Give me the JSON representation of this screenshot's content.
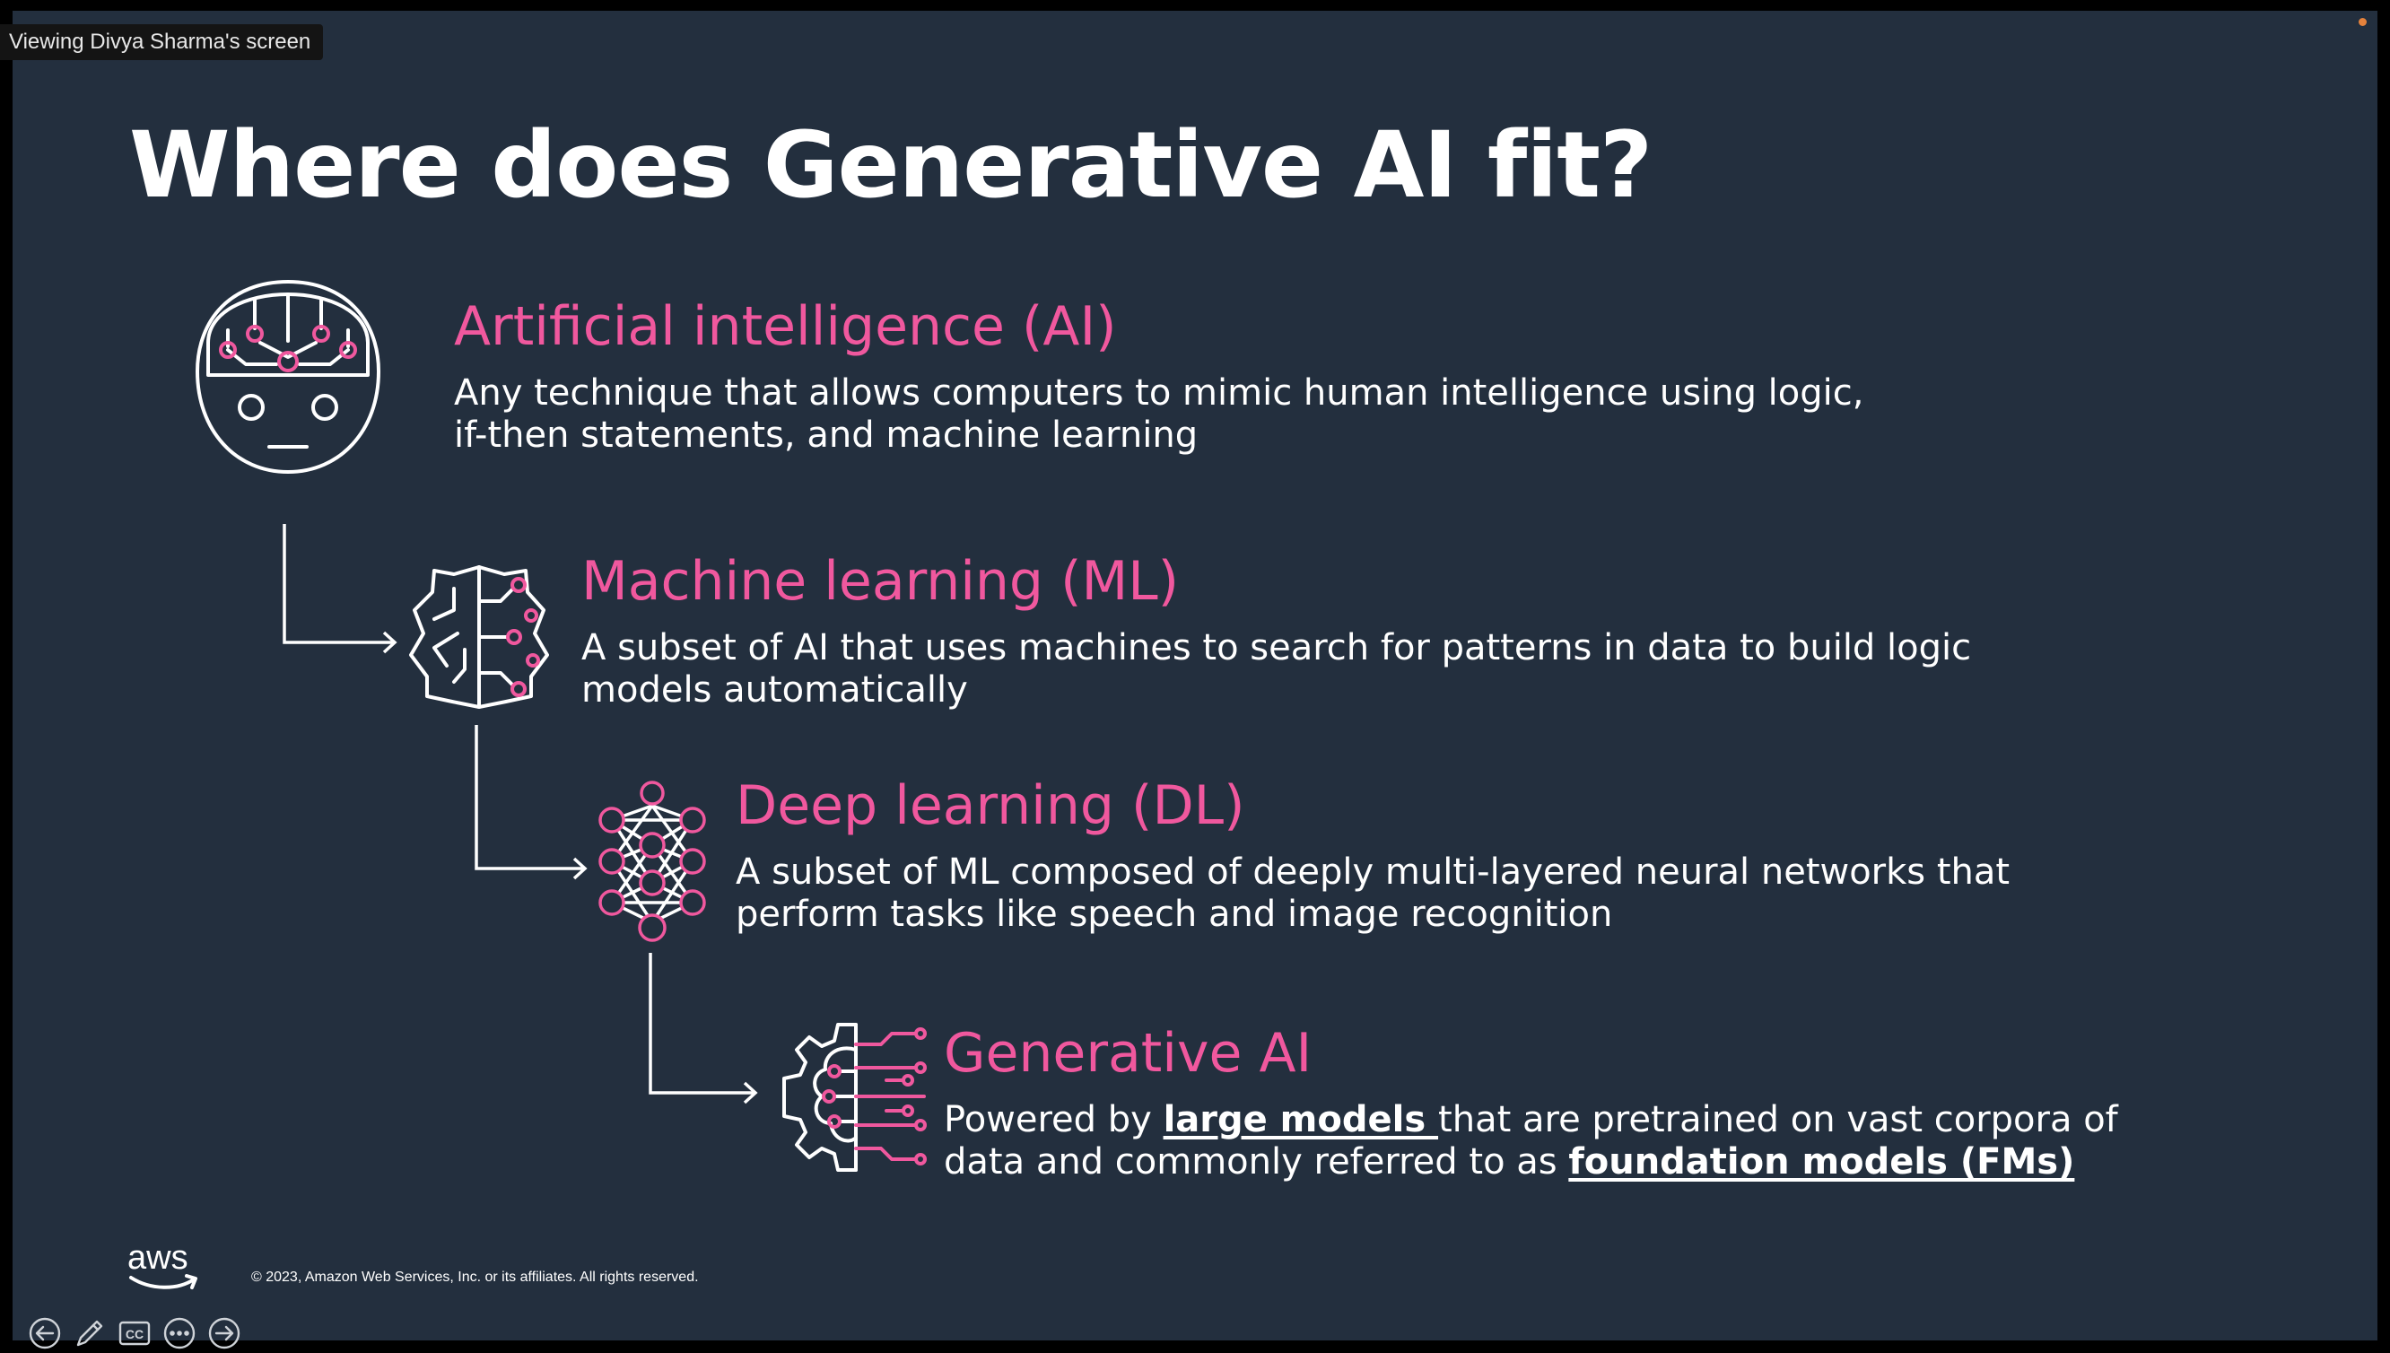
{
  "screen_share": {
    "viewing_label": "Viewing Divya Sharma's screen"
  },
  "slide": {
    "title": "Where does Generative AI fit?",
    "levels": [
      {
        "heading": "Artificial intelligence (AI)",
        "desc_line1": "Any technique that allows computers to mimic human intelligence using logic,",
        "desc_line2": "if-then statements, and machine learning",
        "icon": "ai-head-icon"
      },
      {
        "heading": "Machine learning (ML)",
        "desc_line1": "A subset of AI that uses machines to search for patterns in data to build logic",
        "desc_line2": "models automatically",
        "icon": "brain-circuit-icon"
      },
      {
        "heading": "Deep learning (DL)",
        "desc_line1": "A subset of ML composed of deeply multi-layered neural networks that",
        "desc_line2": "perform tasks like speech and image recognition",
        "icon": "neural-network-icon"
      },
      {
        "heading": "Generative AI",
        "desc_line1_pre": "Powered by ",
        "desc_line1_em": "large models ",
        "desc_line1_post": "that are pretrained on vast corpora of",
        "desc_line2_pre": "data and commonly referred to as ",
        "desc_line2_em": "foundation models (FMs)",
        "icon": "gear-brain-circuit-icon"
      }
    ],
    "footer": {
      "logo_text": "aws",
      "copyright": "© 2023, Amazon Web Services, Inc. or its affiliates. All rights reserved."
    }
  },
  "controls": [
    {
      "name": "previous-slide",
      "icon": "arrow-left-circle-icon"
    },
    {
      "name": "pen-tool",
      "icon": "pencil-icon"
    },
    {
      "name": "captions",
      "icon": "cc-icon",
      "label": "CC"
    },
    {
      "name": "more-options",
      "icon": "more-horizontal-icon"
    },
    {
      "name": "next-slide",
      "icon": "arrow-right-circle-icon"
    }
  ],
  "colors": {
    "slide_background": "#232f3e",
    "accent_pink": "#f0589e",
    "text_white": "#ffffff",
    "recording_dot": "#e4823c"
  }
}
